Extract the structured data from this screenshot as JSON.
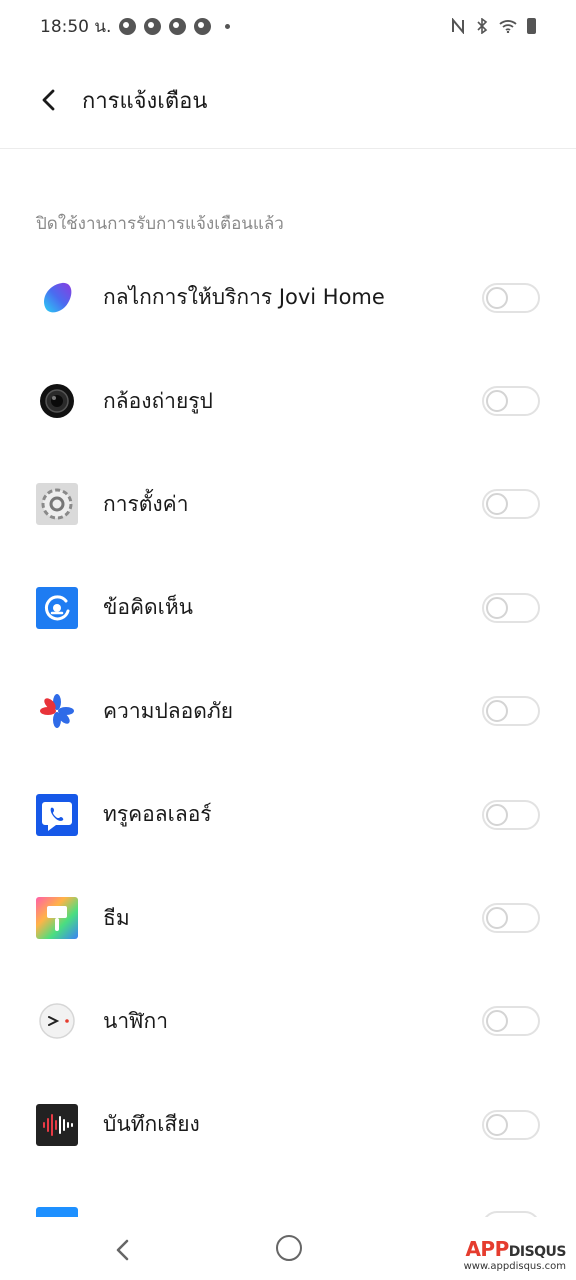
{
  "status_bar": {
    "time": "18:50 น.",
    "icons": [
      "nfc-icon",
      "bluetooth-icon",
      "wifi-icon",
      "battery-icon"
    ]
  },
  "header": {
    "title": "การแจ้งเตือน"
  },
  "section": {
    "label": "ปิดใช้งานการรับการแจ้งเตือนแล้ว"
  },
  "apps": [
    {
      "label": "กลไกการให้บริการ Jovi Home",
      "icon": "jovi-home-icon",
      "enabled": false
    },
    {
      "label": "กล้องถ่ายรูป",
      "icon": "camera-icon",
      "enabled": false
    },
    {
      "label": "การตั้งค่า",
      "icon": "settings-gear-icon",
      "enabled": false
    },
    {
      "label": "ข้อคิดเห็น",
      "icon": "feedback-icon",
      "enabled": false
    },
    {
      "label": "ความปลอดภัย",
      "icon": "security-icon",
      "enabled": false
    },
    {
      "label": "ทรูคอลเลอร์",
      "icon": "truecaller-icon",
      "enabled": false
    },
    {
      "label": "ธีม",
      "icon": "theme-brush-icon",
      "enabled": false
    },
    {
      "label": "นาฬิกา",
      "icon": "clock-icon",
      "enabled": false
    },
    {
      "label": "บันทึกเสียง",
      "icon": "voice-recorder-icon",
      "enabled": false
    }
  ],
  "watermark": {
    "brand_main": "APP",
    "brand_sub": "DISQUS",
    "url": "www.appdisqus.com"
  },
  "colors": {
    "accent_blue": "#1e7cf2",
    "toggle_off_border": "#e2e2e2",
    "section_text": "#8a8a8a"
  }
}
